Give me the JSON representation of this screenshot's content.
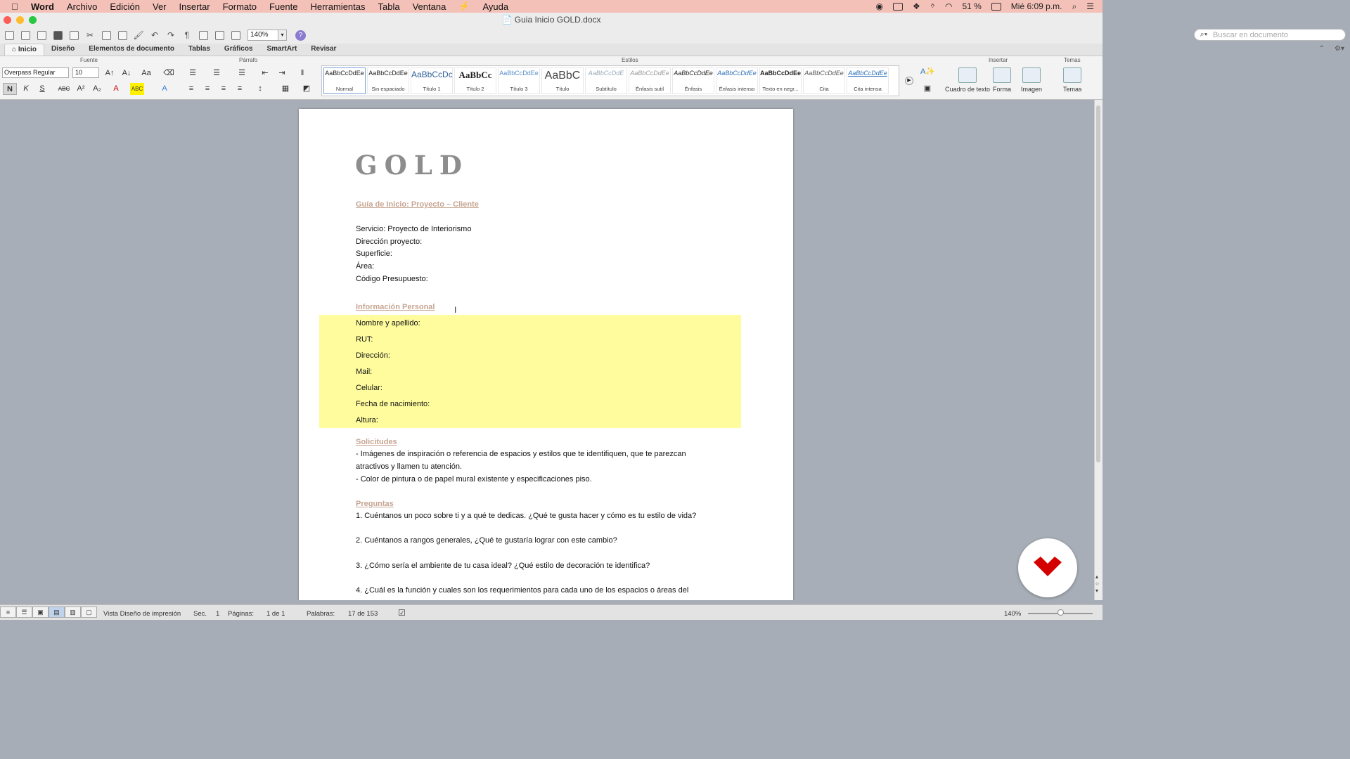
{
  "menubar": {
    "app": "Word",
    "items": [
      "Archivo",
      "Edición",
      "Ver",
      "Insertar",
      "Formato",
      "Fuente",
      "Herramientas",
      "Tabla",
      "Ventana",
      "Ayuda"
    ],
    "battery": "51 %",
    "clock": "Mié 6:09 p.m."
  },
  "window": {
    "title": "Guia Inicio GOLD.docx"
  },
  "toolbar": {
    "zoom": "140%",
    "search_placeholder": "Buscar en documento"
  },
  "tabs": [
    "Inicio",
    "Diseño",
    "Elementos de documento",
    "Tablas",
    "Gráficos",
    "SmartArt",
    "Revisar"
  ],
  "ribbon": {
    "groups": {
      "font": "Fuente",
      "paragraph": "Párrafo",
      "styles": "Estilos",
      "insert": "Insertar",
      "themes": "Temas"
    },
    "font_name": "Overpass Regular",
    "font_size": "10",
    "styles": [
      {
        "preview": "AaBbCcDdEe",
        "name": "Normal"
      },
      {
        "preview": "AaBbCcDdEe",
        "name": "Sin espaciado"
      },
      {
        "preview": "AaBbCcDc",
        "name": "Título 1"
      },
      {
        "preview": "AaBbCc",
        "name": "Título 2"
      },
      {
        "preview": "AaBbCcDdEe",
        "name": "Título 3"
      },
      {
        "preview": "AaBbC",
        "name": "Título"
      },
      {
        "preview": "AaBbCcDdE",
        "name": "Subtítulo"
      },
      {
        "preview": "AaBbCcDdEe",
        "name": "Énfasis sutil"
      },
      {
        "preview": "AaBbCcDdEe",
        "name": "Énfasis"
      },
      {
        "preview": "AaBbCcDdEe",
        "name": "Énfasis intenso"
      },
      {
        "preview": "AaBbCcDdEe",
        "name": "Texto en negr..."
      },
      {
        "preview": "AaBbCcDdEe",
        "name": "Cita"
      },
      {
        "preview": "AaBbCcDdEe",
        "name": "Cita intensa"
      }
    ],
    "insert": {
      "textbox": "Cuadro de texto",
      "shape": "Forma",
      "image": "Imagen"
    },
    "themes": "Temas"
  },
  "document": {
    "logo": "GOLD",
    "section1_title": "Guía de Inicio: Proyecto – Cliente",
    "section1_lines": [
      "Servicio: Proyecto de Interiorismo",
      "Dirección proyecto:",
      "Superficie:",
      "Área:",
      "Código Presupuesto:"
    ],
    "section2_title": "Información Personal",
    "section2_lines": [
      "Nombre y apellido:",
      "RUT:",
      "Dirección:",
      "Mail:",
      "Celular:",
      "Fecha de nacimiento:",
      "Altura:"
    ],
    "section3_title": "Solicitudes",
    "section3_lines": [
      "- Imágenes de inspiración o referencia de espacios y estilos que te identifiquen, que te parezcan",
      "atractivos y llamen tu atención.",
      "- Color de pintura o de papel mural existente y especificaciones piso."
    ],
    "section4_title": "Preguntas",
    "questions": [
      "1. Cuéntanos un poco sobre ti y a qué te dedicas. ¿Qué te gusta hacer y cómo es tu estilo de vida?",
      "2. Cuéntanos a rangos generales, ¿Qué te gustaría lograr con este cambio?",
      "3. ¿Cómo sería el ambiente de tu casa ideal?  ¿Qué estilo de decoración te identifica?",
      "4. ¿Cuál es la función y cuales son los requerimientos para cada uno de los espacios o áreas del"
    ]
  },
  "statusbar": {
    "view": "Vista Diseño de impresión",
    "section_label": "Sec.",
    "section_value": "1",
    "pages_label": "Páginas:",
    "pages_value": "1 de 1",
    "words_label": "Palabras:",
    "words_value": "17 de 153",
    "zoom": "140%"
  },
  "colors": {
    "menubar": "#f4c1b8",
    "heading": "#c6a592",
    "highlight": "#fffc9e",
    "badge_icon": "#d40000"
  }
}
